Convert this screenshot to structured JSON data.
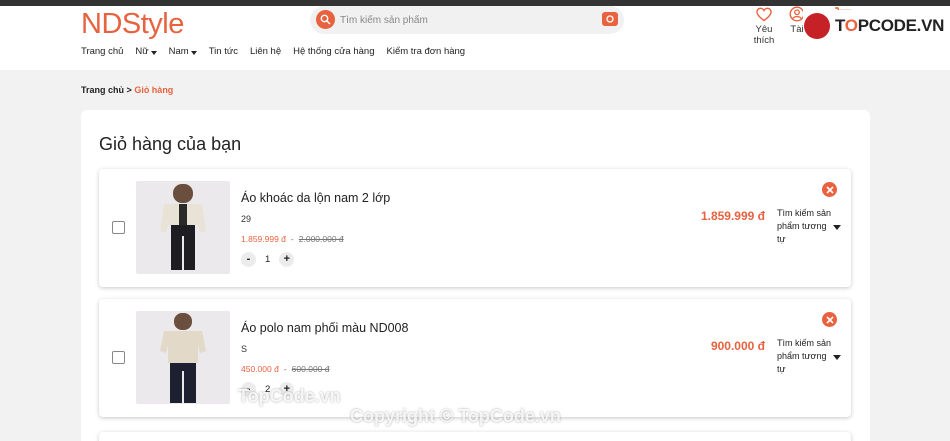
{
  "header": {
    "logo_part1": "ND",
    "logo_part2": "Style",
    "search_placeholder": "Tìm kiếm sản phẩm",
    "wishlist_label": "Yêu thích",
    "account_label": "Tài",
    "brand_color": "#e8623f"
  },
  "nav": {
    "items": [
      {
        "label": "Trang chủ",
        "dropdown": false
      },
      {
        "label": "Nữ",
        "dropdown": true
      },
      {
        "label": "Nam",
        "dropdown": true
      },
      {
        "label": "Tin tức",
        "dropdown": false
      },
      {
        "label": "Liên hệ",
        "dropdown": false
      },
      {
        "label": "Hệ thống cửa hàng",
        "dropdown": false
      },
      {
        "label": "Kiểm tra đơn hàng",
        "dropdown": false
      }
    ]
  },
  "breadcrumb": {
    "home": "Trang chủ",
    "separator": ">",
    "current": "Giỏ hàng"
  },
  "cart": {
    "title": "Giỏ hàng của bạn",
    "similar_label": "Tìm kiếm sản phẩm tương tự",
    "items": [
      {
        "name": "Áo khoác da lộn nam 2 lớp",
        "variant": "29",
        "sale_price": "1.859.999 đ",
        "price_separator": "-",
        "original_price": "2.000.000 đ",
        "quantity": "1",
        "minus": "-",
        "plus": "+",
        "total": "1.859.999 đ"
      },
      {
        "name": "Áo polo nam phối màu ND008",
        "variant": "S",
        "sale_price": "450.000 đ",
        "price_separator": "-",
        "original_price": "600.000 đ",
        "quantity": "2",
        "minus": "-",
        "plus": "+",
        "total": "900.000 đ"
      }
    ]
  },
  "watermarks": {
    "text1": "TopCode.vn",
    "text2": "Copyright © TopCode.vn",
    "logo_text_prefix": "T",
    "logo_text_o": "O",
    "logo_text_suffix": "PCODE.VN"
  }
}
